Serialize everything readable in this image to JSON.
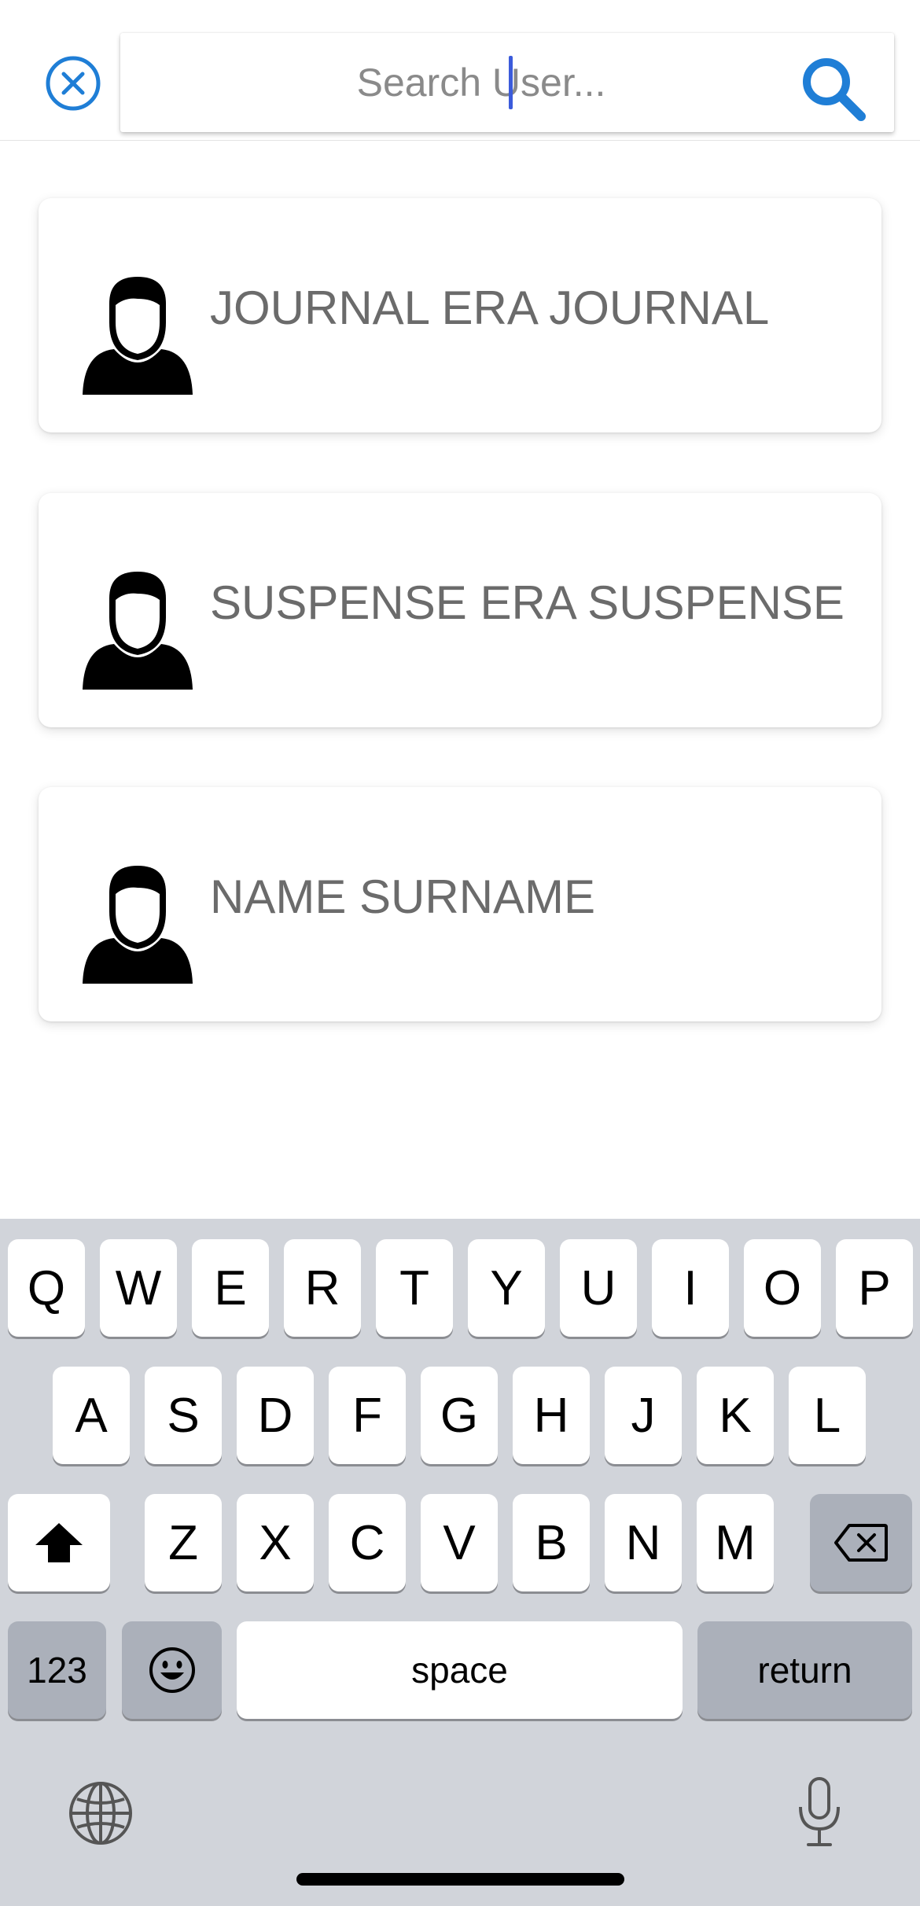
{
  "header": {
    "search_placeholder": "Search User...",
    "search_value": ""
  },
  "results": [
    {
      "name": "JOURNAL ERA JOURNAL"
    },
    {
      "name": "SUSPENSE ERA SUSPENSE"
    },
    {
      "name": "NAME SURNAME"
    }
  ],
  "keyboard": {
    "row1": [
      "Q",
      "W",
      "E",
      "R",
      "T",
      "Y",
      "U",
      "I",
      "O",
      "P"
    ],
    "row2": [
      "A",
      "S",
      "D",
      "F",
      "G",
      "H",
      "J",
      "K",
      "L"
    ],
    "row3": [
      "Z",
      "X",
      "C",
      "V",
      "B",
      "N",
      "M"
    ],
    "numbers_label": "123",
    "space_label": "space",
    "return_label": "return"
  },
  "colors": {
    "accent": "#1f7ed6",
    "caret": "#3b5bdb",
    "keyboard_bg": "#d1d4da"
  },
  "icons": {
    "close": "close-circle-icon",
    "search": "search-icon",
    "avatar": "user-avatar-icon",
    "shift": "shift-icon",
    "backspace": "backspace-icon",
    "emoji": "emoji-icon",
    "globe": "globe-icon",
    "mic": "microphone-icon"
  }
}
